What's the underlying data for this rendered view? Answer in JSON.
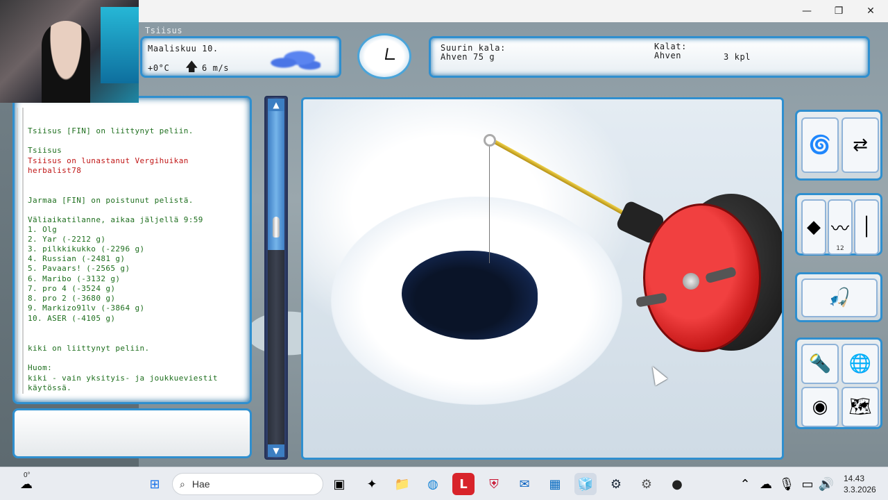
{
  "window": {
    "minimize": "—",
    "restore": "❐",
    "close": "✕"
  },
  "player_name": "Tsiisus",
  "weather": {
    "date": "Maaliskuu 10.",
    "temperature": "+0°C",
    "wind_arrow": "🡅",
    "wind": "6 m/s",
    "icon": "cloud-icon"
  },
  "catch": {
    "biggest_label": "Suurin kala:",
    "biggest_value": "Ahven 75 g",
    "fish_label": "Kalat:",
    "fish_name": "Ahven",
    "fish_count": "3 kpl"
  },
  "chat": {
    "lines": [
      {
        "text": "Tsiisus [FIN] on liittynyt peliin.",
        "color": "green"
      },
      {
        "text": "Tsiisus",
        "color": "green"
      },
      {
        "text": "Tsiisus on lunastanut Vergihuikan",
        "color": "red"
      },
      {
        "text": "herbalist78",
        "color": "red"
      },
      {
        "text": "Jarmaa [FIN] on poistunut pelistä.",
        "color": "green"
      },
      {
        "text": "Väliaikatilanne, aikaa jäljellä 9:59",
        "color": "green"
      },
      {
        "text": "1. Olg",
        "color": "green"
      },
      {
        "text": "2. Yar (-2212 g)",
        "color": "green"
      },
      {
        "text": "3. pilkkikukko (-2296 g)",
        "color": "green"
      },
      {
        "text": "4. Russian (-2481 g)",
        "color": "green"
      },
      {
        "text": "5. Pavaars! (-2565 g)",
        "color": "green"
      },
      {
        "text": "6. Maribo (-3132 g)",
        "color": "green"
      },
      {
        "text": "7. pro 4 (-3524 g)",
        "color": "green"
      },
      {
        "text": "8. pro 2 (-3680 g)",
        "color": "green"
      },
      {
        "text": "9. Markizo91lv (-3864 g)",
        "color": "green"
      },
      {
        "text": "10. ASER (-4105 g)",
        "color": "green"
      },
      {
        "text": "kiki on liittynyt peliin.",
        "color": "green"
      },
      {
        "text": "Huom:",
        "color": "green"
      },
      {
        "text": "kiki - vain yksityis- ja joukkueviestit",
        "color": "green"
      },
      {
        "text": "käytössä.",
        "color": "green"
      }
    ]
  },
  "depth": {
    "up_arrow": "▲",
    "down_arrow": "▼",
    "level": 0.4
  },
  "tools": {
    "auger_icon": "ice-auger-icon",
    "lure_count": "12"
  },
  "taskbar": {
    "weather_temp": "0°",
    "search_placeholder": "Hae",
    "time": "14.43",
    "date": "3.3.2026"
  },
  "colors": {
    "accent": "#2f8fcf",
    "chat_green": "#1d6e1d",
    "chat_red": "#c01515",
    "reel_red": "#c61818"
  }
}
